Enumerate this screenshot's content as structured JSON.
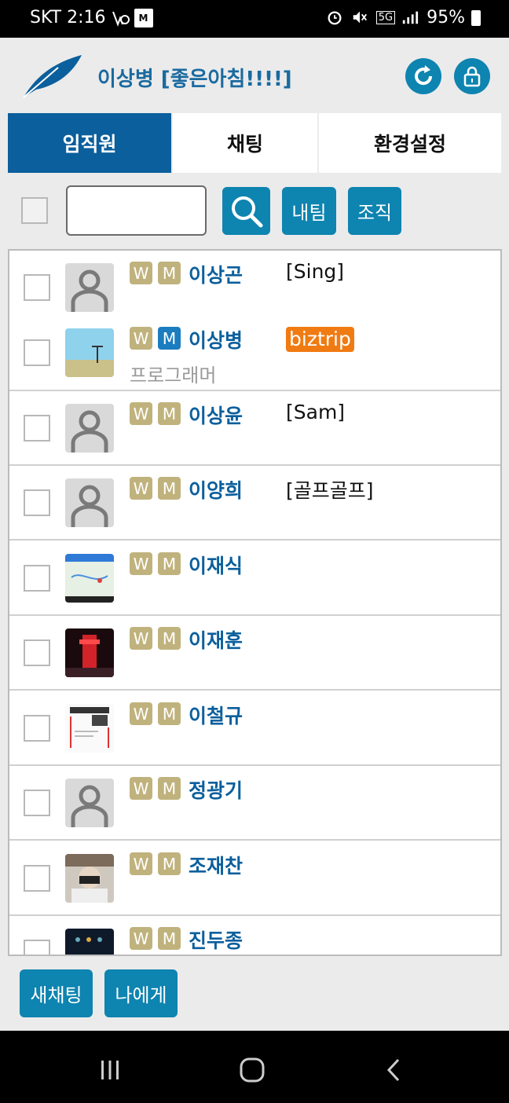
{
  "statusbar": {
    "carrier_time": "SKT 2:16",
    "mstock_label": "M",
    "network": "5G",
    "battery": "95%"
  },
  "header": {
    "title": "이상병 [좋은아침!!!!]"
  },
  "tabs": [
    {
      "label": "임직원",
      "active": true
    },
    {
      "label": "채팅",
      "active": false
    },
    {
      "label": "환경설정",
      "active": false
    }
  ],
  "toolbar": {
    "search_value": "",
    "btn_naetim": "내팀",
    "btn_jojik": "조직"
  },
  "employees": [
    {
      "name": "이상곤",
      "status": "[Sing]",
      "role": "",
      "badges": [
        "W",
        "M"
      ],
      "avatar": "default"
    },
    {
      "name": "이상병",
      "status": "biztrip",
      "role": "프로그래머",
      "badges": [
        "W",
        "M"
      ],
      "avatar": "photo-landscape"
    },
    {
      "name": "이상윤",
      "status": "[Sam]",
      "role": "",
      "badges": [
        "W",
        "M"
      ],
      "avatar": "default"
    },
    {
      "name": "이양희",
      "status": "[골프골프]",
      "role": "",
      "badges": [
        "W",
        "M"
      ],
      "avatar": "default"
    },
    {
      "name": "이재식",
      "status": "",
      "role": "",
      "badges": [
        "W",
        "M"
      ],
      "avatar": "photo-map"
    },
    {
      "name": "이재훈",
      "status": "",
      "role": "",
      "badges": [
        "W",
        "M"
      ],
      "avatar": "photo-tower"
    },
    {
      "name": "이철규",
      "status": "",
      "role": "",
      "badges": [
        "W",
        "M"
      ],
      "avatar": "photo-doc"
    },
    {
      "name": "정광기",
      "status": "",
      "role": "",
      "badges": [
        "W",
        "M"
      ],
      "avatar": "default"
    },
    {
      "name": "조재찬",
      "status": "",
      "role": "",
      "badges": [
        "W",
        "M"
      ],
      "avatar": "photo-person"
    },
    {
      "name": "진두종",
      "status": "",
      "role": "",
      "badges": [
        "W",
        "M"
      ],
      "avatar": "photo-dark"
    }
  ],
  "bottom": {
    "new_chat": "새채팅",
    "to_me": "나에게"
  },
  "colors": {
    "accent": "#0e84b0",
    "tab_active": "#0b5f9c",
    "name": "#0b5f9c",
    "badge": "#c0b27d",
    "badge_online": "#1b7dbf",
    "biztrip": "#f07b12"
  }
}
